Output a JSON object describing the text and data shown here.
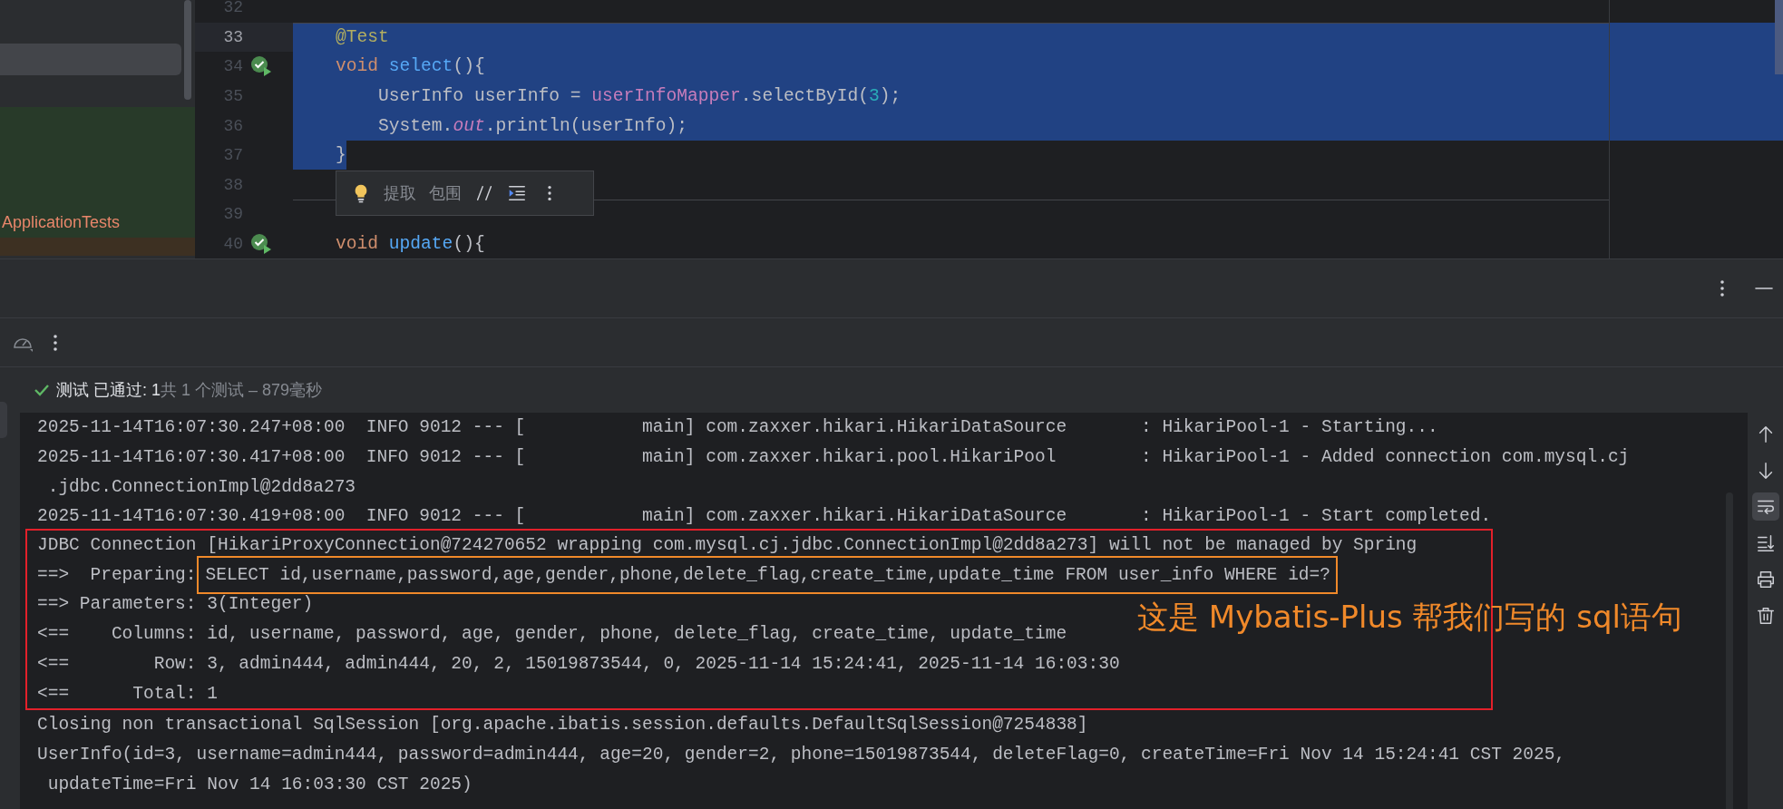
{
  "project_panel": {
    "rows": [
      {
        "kind": "blank",
        "selected": true
      },
      {
        "kind": "file",
        "label": "ApplicationTests",
        "selected": false
      }
    ]
  },
  "editor": {
    "lines": [
      {
        "number": "32",
        "kind": "code",
        "current": false
      },
      {
        "number": "33",
        "kind": "code",
        "current": true,
        "separator": true,
        "selected": true,
        "tokens": [
          {
            "kind": "annotation",
            "text": "    @Test"
          }
        ]
      },
      {
        "number": "34",
        "kind": "test",
        "current": false,
        "selected": true,
        "tokens": [
          {
            "kind": "keyword",
            "text": "    void "
          },
          {
            "kind": "method",
            "text": "select"
          },
          {
            "kind": "plain",
            "text": "(){"
          }
        ]
      },
      {
        "number": "35",
        "kind": "code",
        "current": false,
        "selected": true,
        "tokens": [
          {
            "kind": "plain",
            "text": "        UserInfo userInfo = "
          },
          {
            "kind": "field",
            "text": "userInfoMapper"
          },
          {
            "kind": "plain",
            "text": ".selectById("
          },
          {
            "kind": "number",
            "text": "3"
          },
          {
            "kind": "plain",
            "text": ");"
          }
        ]
      },
      {
        "number": "36",
        "kind": "code",
        "current": false,
        "selected": true,
        "tokens": [
          {
            "kind": "plain",
            "text": "        System."
          },
          {
            "kind": "static",
            "text": "out"
          },
          {
            "kind": "plain",
            "text": ".println(userInfo);"
          }
        ]
      },
      {
        "number": "37",
        "kind": "code",
        "current": false,
        "selected": false,
        "text_selected": true,
        "tokens": [
          {
            "kind": "plain",
            "text": "    }"
          }
        ]
      },
      {
        "number": "38",
        "kind": "code",
        "current": false
      },
      {
        "number": "39",
        "kind": "code",
        "current": false,
        "separator": true,
        "selected": false
      },
      {
        "number": "40",
        "kind": "test",
        "current": false,
        "selected": false,
        "tokens": [
          {
            "kind": "keyword",
            "text": "    void "
          },
          {
            "kind": "method",
            "text": "update"
          },
          {
            "kind": "plain",
            "text": "(){"
          }
        ]
      }
    ]
  },
  "intention_popup": {
    "items": [
      {
        "kind": "bulb"
      },
      {
        "kind": "text",
        "label": "提取"
      },
      {
        "kind": "text",
        "label": "包围"
      },
      {
        "kind": "comment"
      },
      {
        "kind": "indent"
      },
      {
        "kind": "more"
      }
    ]
  },
  "tool_window": {
    "header_actions": [
      {
        "kind": "more"
      },
      {
        "kind": "minimize"
      }
    ],
    "toolbar": [
      {
        "kind": "gauge"
      },
      {
        "kind": "more"
      }
    ],
    "status": {
      "passed": true,
      "result": "测试 已通过: 1",
      "summary": "共 1 个测试 – 879毫秒"
    }
  },
  "console": {
    "lines": [
      {
        "text": "2025-11-14T16:07:30.247+08:00  INFO 9012 --- [           main] com.zaxxer.hikari.HikariDataSource       : HikariPool-1 - Starting...",
        "boxed": false
      },
      {
        "text": "2025-11-14T16:07:30.417+08:00  INFO 9012 --- [           main] com.zaxxer.hikari.pool.HikariPool        : HikariPool-1 - Added connection com.mysql.cj",
        "boxed": false
      },
      {
        "text": " .jdbc.ConnectionImpl@2dd8a273",
        "boxed": false
      },
      {
        "text": "2025-11-14T16:07:30.419+08:00  INFO 9012 --- [           main] com.zaxxer.hikari.HikariDataSource       : HikariPool-1 - Start completed.",
        "boxed": false
      },
      {
        "text": "JDBC Connection [HikariProxyConnection@724270652 wrapping com.mysql.cj.jdbc.ConnectionImpl@2dd8a273] will not be managed by Spring",
        "boxed": true
      },
      {
        "text": "==>  Preparing:",
        "highlighted": "SELECT id,username,password,age,gender,phone,delete_flag,create_time,update_time FROM user_info WHERE id=?",
        "boxed": true
      },
      {
        "text": "==> Parameters: 3(Integer)",
        "boxed": true
      },
      {
        "text": "<==    Columns: id, username, password, age, gender, phone, delete_flag, create_time, update_time",
        "boxed": true
      },
      {
        "text": "<==        Row: 3, admin444, admin444, 20, 2, 15019873544, 0, 2025-11-14 15:24:41, 2025-11-14 16:03:30",
        "boxed": true
      },
      {
        "text": "<==      Total: 1",
        "boxed": true
      },
      {
        "text": "Closing non transactional SqlSession [org.apache.ibatis.session.defaults.DefaultSqlSession@7254838]",
        "boxed": false
      },
      {
        "text": "UserInfo(id=3, username=admin444, password=admin444, age=20, gender=2, phone=15019873544, deleteFlag=0, createTime=Fri Nov 14 15:24:41 CST 2025,",
        "boxed": false
      },
      {
        "text": " updateTime=Fri Nov 14 16:03:30 CST 2025)",
        "boxed": false
      }
    ],
    "annotation": "这是 Mybatis-Plus 帮我们写的 sql语句",
    "side_actions": [
      {
        "kind": "up",
        "selected": false
      },
      {
        "kind": "down",
        "selected": false
      },
      {
        "kind": "wrap",
        "selected": true
      },
      {
        "kind": "scroll_end",
        "selected": false
      },
      {
        "kind": "print",
        "selected": false
      },
      {
        "kind": "clear",
        "selected": false
      }
    ]
  }
}
